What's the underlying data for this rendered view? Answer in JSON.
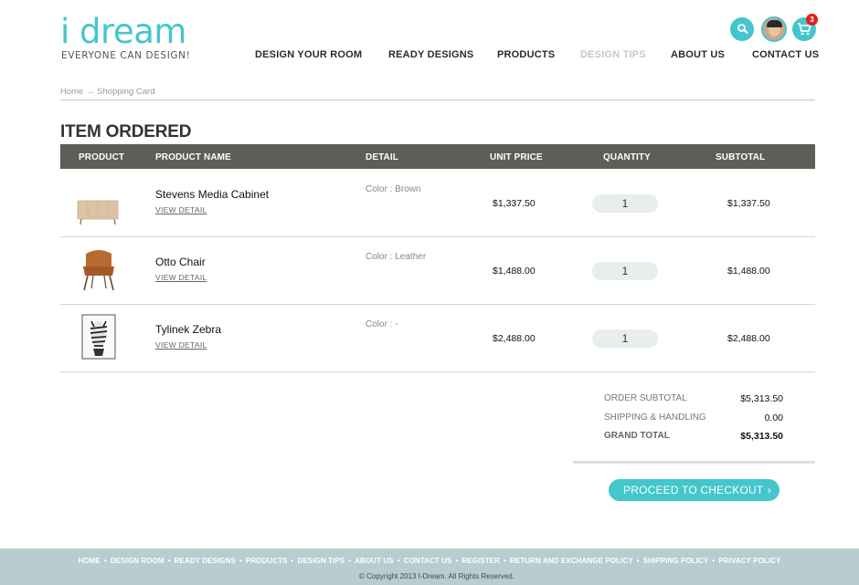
{
  "brand": {
    "logo_text": "i dream",
    "tagline": "EVERYONE CAN DESIGN!",
    "accent_color": "#43c6cc"
  },
  "nav": {
    "items": [
      {
        "label": "DESIGN YOUR ROOM"
      },
      {
        "label": "READY DESIGNS"
      },
      {
        "label": "PRODUCTS"
      },
      {
        "label": "DESIGN TIPS"
      },
      {
        "label": "ABOUT US"
      },
      {
        "label": "CONTACT US"
      }
    ]
  },
  "header_icons": {
    "search": "search-icon",
    "avatar": "user-avatar",
    "cart": "cart-icon",
    "cart_count": "3"
  },
  "breadcrumb": {
    "home": "Home",
    "separator": "→",
    "current": "Shopping Card"
  },
  "page_title": "ITEM ORDERED",
  "table": {
    "columns": [
      "PRODUCT",
      "PRODUCT NAME",
      "DETAIL",
      "UNIT PRICE",
      "QUANTITY",
      "SUBTOTAL"
    ],
    "rows": [
      {
        "name": "Stevens Media Cabinet",
        "view_label": "VIEW DETAIL",
        "detail": "Color : Brown",
        "unit_price": "$1,337.50",
        "quantity": "1",
        "subtotal": "$1,337.50",
        "thumb": "cabinet-thumbnail"
      },
      {
        "name": "Otto Chair",
        "view_label": "VIEW DETAIL",
        "detail": "Color : Leather",
        "unit_price": "$1,488.00",
        "quantity": "1",
        "subtotal": "$1,488.00",
        "thumb": "chair-thumbnail"
      },
      {
        "name": "Tylinek Zebra",
        "view_label": "VIEW DETAIL",
        "detail": "Color : -",
        "unit_price": "$2,488.00",
        "quantity": "1",
        "subtotal": "$2,488.00",
        "thumb": "zebra-print-thumbnail"
      }
    ]
  },
  "summary": {
    "order_subtotal_label": "ORDER SUBTOTAL",
    "order_subtotal": "$5,313.50",
    "shipping_label": "SHIPPING & HANDLING",
    "shipping": "0.00",
    "grand_total_label": "GRAND TOTAL",
    "grand_total": "$5,313.50"
  },
  "checkout": {
    "label": "PROCEED TO CHECKOUT",
    "chevron": "›"
  },
  "footer": {
    "links": [
      "HOME",
      "DESIGN ROOM",
      "READY DESIGNS",
      "PRODUCTS",
      "DESIGN TIPS",
      "ABOUT US",
      "CONTACT US",
      "REGISTER",
      "RETURN AND EXCHANGE POLICY",
      "SHIPPING POLICY",
      "PRIVACY POLICY"
    ],
    "separator": "•",
    "copyright": "© Copyright 2013 I-Dream. All Rights Reserved."
  }
}
